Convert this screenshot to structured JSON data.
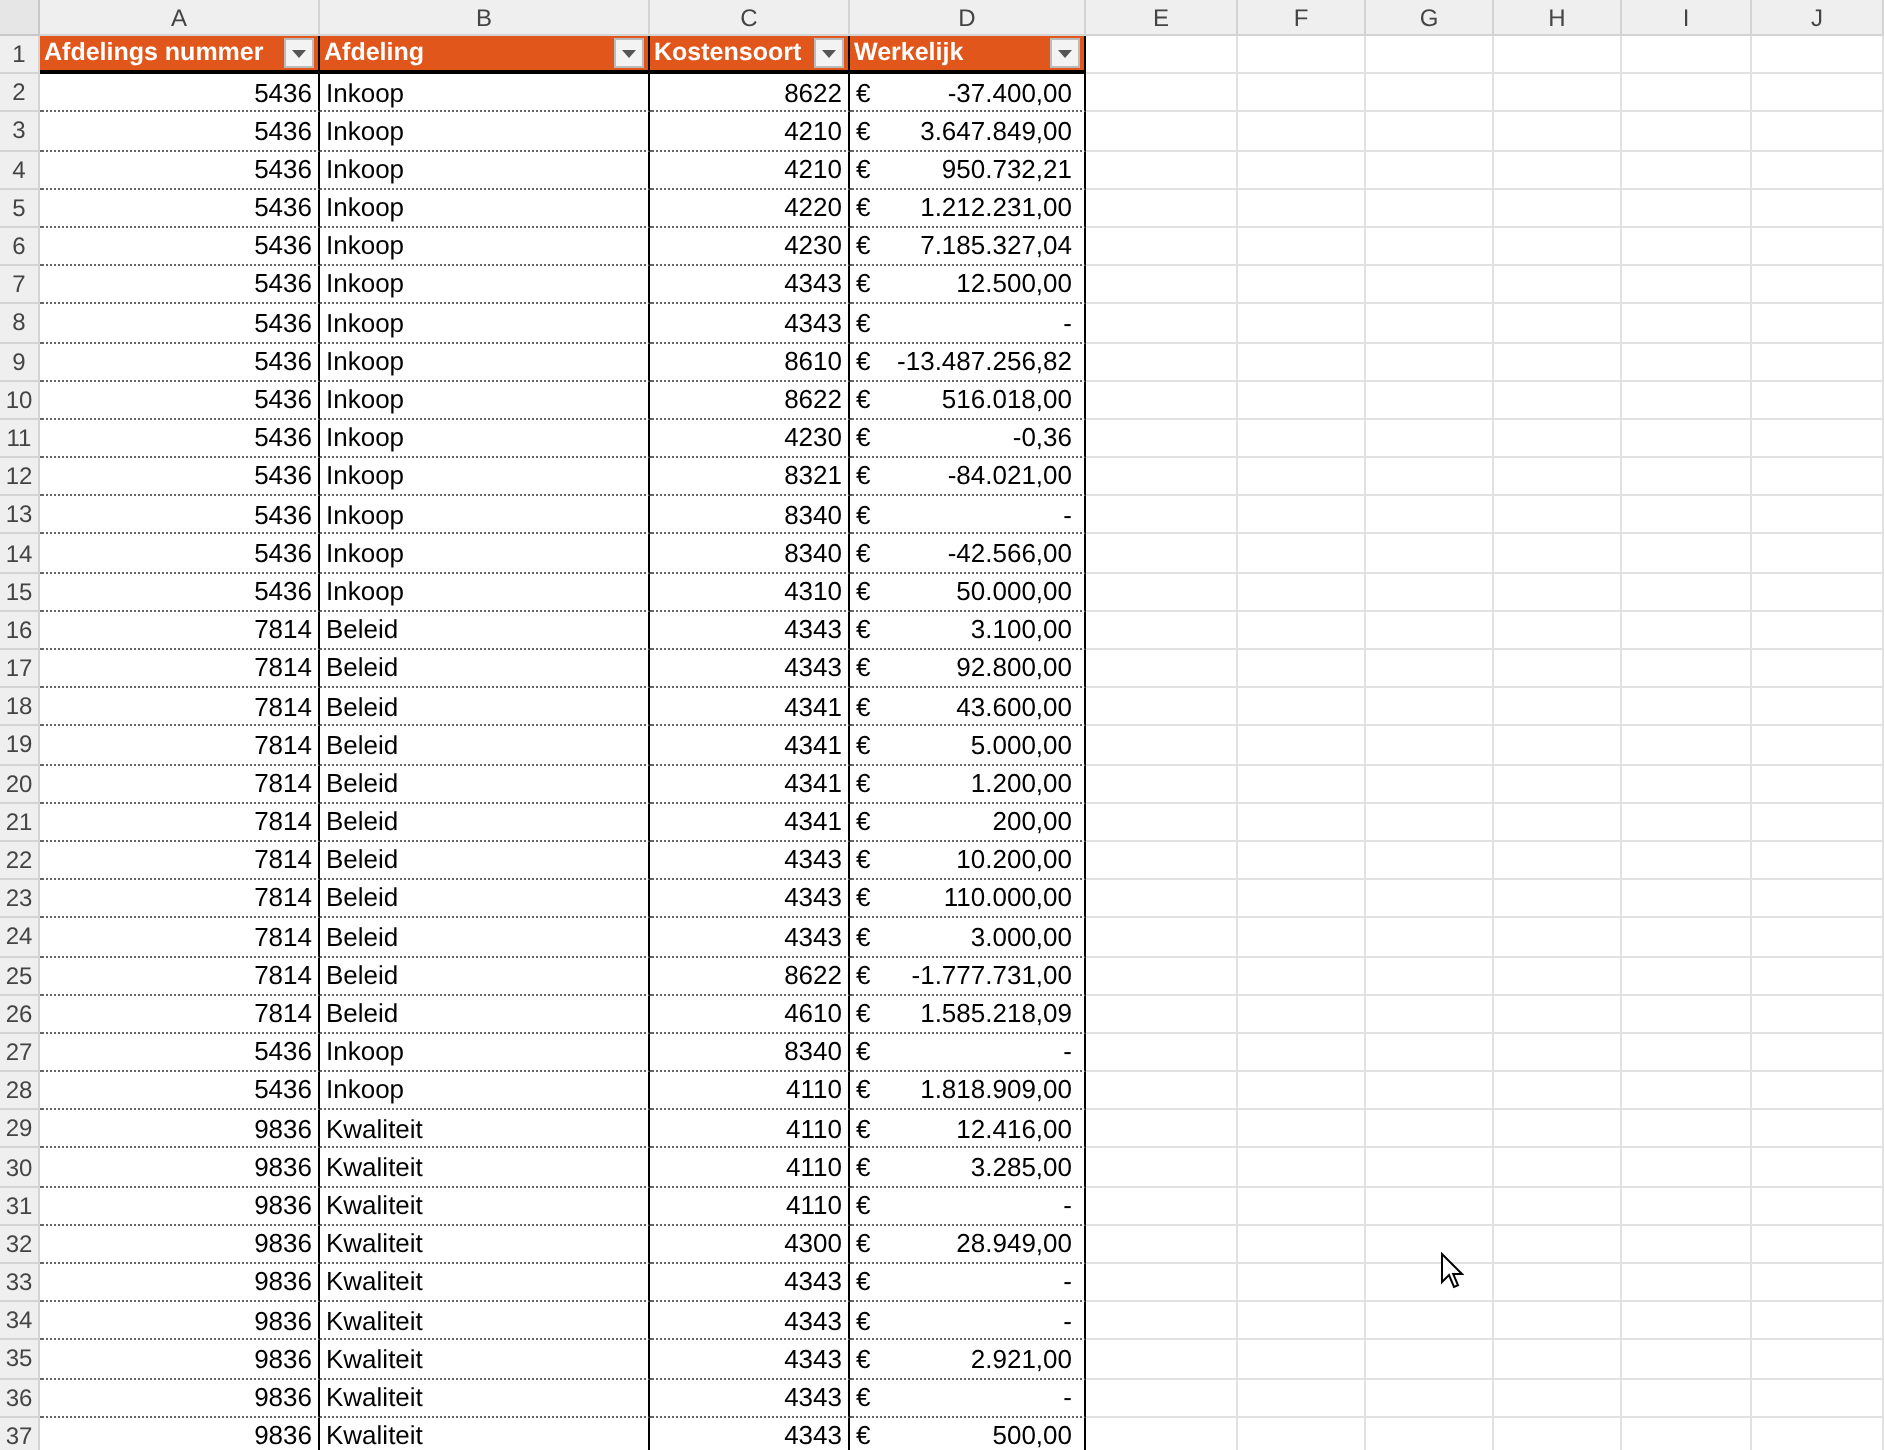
{
  "columns": [
    "A",
    "B",
    "C",
    "D",
    "E",
    "F",
    "G",
    "H",
    "I",
    "J"
  ],
  "header": [
    {
      "label": "Afdelings nummer"
    },
    {
      "label": "Afdeling"
    },
    {
      "label": "Kostensoort"
    },
    {
      "label": "Werkelijk"
    }
  ],
  "rows": [
    [
      "2",
      "5436",
      "Inkoop",
      "8622",
      "€",
      "-37.400,00"
    ],
    [
      "3",
      "5436",
      "Inkoop",
      "4210",
      "€",
      "3.647.849,00"
    ],
    [
      "4",
      "5436",
      "Inkoop",
      "4210",
      "€",
      "950.732,21"
    ],
    [
      "5",
      "5436",
      "Inkoop",
      "4220",
      "€",
      "1.212.231,00"
    ],
    [
      "6",
      "5436",
      "Inkoop",
      "4230",
      "€",
      "7.185.327,04"
    ],
    [
      "7",
      "5436",
      "Inkoop",
      "4343",
      "€",
      "12.500,00"
    ],
    [
      "8",
      "5436",
      "Inkoop",
      "4343",
      "€",
      "-"
    ],
    [
      "9",
      "5436",
      "Inkoop",
      "8610",
      "€",
      "-13.487.256,82"
    ],
    [
      "10",
      "5436",
      "Inkoop",
      "8622",
      "€",
      "516.018,00"
    ],
    [
      "11",
      "5436",
      "Inkoop",
      "4230",
      "€",
      "-0,36"
    ],
    [
      "12",
      "5436",
      "Inkoop",
      "8321",
      "€",
      "-84.021,00"
    ],
    [
      "13",
      "5436",
      "Inkoop",
      "8340",
      "€",
      "-"
    ],
    [
      "14",
      "5436",
      "Inkoop",
      "8340",
      "€",
      "-42.566,00"
    ],
    [
      "15",
      "5436",
      "Inkoop",
      "4310",
      "€",
      "50.000,00"
    ],
    [
      "16",
      "7814",
      "Beleid",
      "4343",
      "€",
      "3.100,00"
    ],
    [
      "17",
      "7814",
      "Beleid",
      "4343",
      "€",
      "92.800,00"
    ],
    [
      "18",
      "7814",
      "Beleid",
      "4341",
      "€",
      "43.600,00"
    ],
    [
      "19",
      "7814",
      "Beleid",
      "4341",
      "€",
      "5.000,00"
    ],
    [
      "20",
      "7814",
      "Beleid",
      "4341",
      "€",
      "1.200,00"
    ],
    [
      "21",
      "7814",
      "Beleid",
      "4341",
      "€",
      "200,00"
    ],
    [
      "22",
      "7814",
      "Beleid",
      "4343",
      "€",
      "10.200,00"
    ],
    [
      "23",
      "7814",
      "Beleid",
      "4343",
      "€",
      "110.000,00"
    ],
    [
      "24",
      "7814",
      "Beleid",
      "4343",
      "€",
      "3.000,00"
    ],
    [
      "25",
      "7814",
      "Beleid",
      "8622",
      "€",
      "-1.777.731,00"
    ],
    [
      "26",
      "7814",
      "Beleid",
      "4610",
      "€",
      "1.585.218,09"
    ],
    [
      "27",
      "5436",
      "Inkoop",
      "8340",
      "€",
      "-"
    ],
    [
      "28",
      "5436",
      "Inkoop",
      "4110",
      "€",
      "1.818.909,00"
    ],
    [
      "29",
      "9836",
      "Kwaliteit",
      "4110",
      "€",
      "12.416,00"
    ],
    [
      "30",
      "9836",
      "Kwaliteit",
      "4110",
      "€",
      "3.285,00"
    ],
    [
      "31",
      "9836",
      "Kwaliteit",
      "4110",
      "€",
      "-"
    ],
    [
      "32",
      "9836",
      "Kwaliteit",
      "4300",
      "€",
      "28.949,00"
    ],
    [
      "33",
      "9836",
      "Kwaliteit",
      "4343",
      "€",
      "-"
    ],
    [
      "34",
      "9836",
      "Kwaliteit",
      "4343",
      "€",
      "-"
    ],
    [
      "35",
      "9836",
      "Kwaliteit",
      "4343",
      "€",
      "2.921,00"
    ],
    [
      "36",
      "9836",
      "Kwaliteit",
      "4343",
      "€",
      "-"
    ],
    [
      "37",
      "9836",
      "Kwaliteit",
      "4343",
      "€",
      "500,00"
    ]
  ],
  "header_row_number": "1"
}
